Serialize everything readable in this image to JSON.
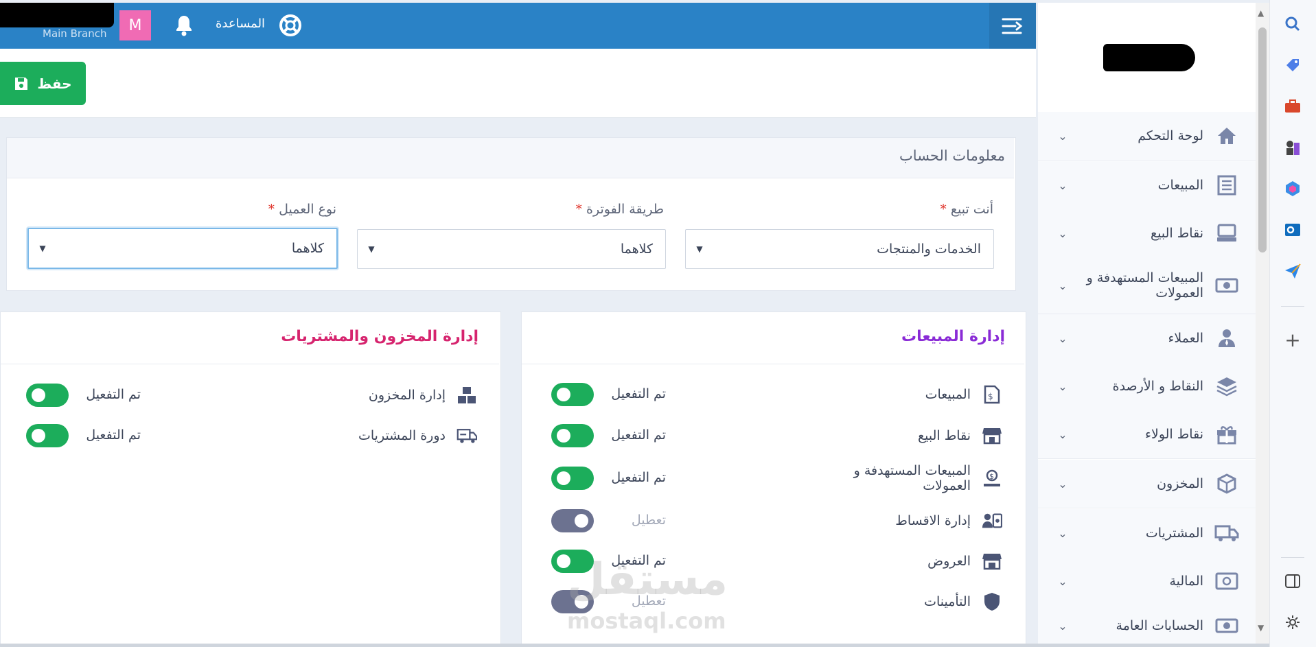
{
  "topbar": {
    "branch": "Main Branch",
    "avatar_initial": "M",
    "help_label": "المساعدة",
    "colors": {
      "bar": "#2a82c6",
      "avatar": "#f06bb4"
    }
  },
  "toolbar": {
    "save_label": "حفظ",
    "save_color": "#1cad5b"
  },
  "sidebar": {
    "items": [
      {
        "label": "لوحة التحكم",
        "icon": "home-icon"
      },
      {
        "label": "المبيعات",
        "icon": "receipt-icon"
      },
      {
        "label": "نقاط البيع",
        "icon": "pos-terminal-icon"
      },
      {
        "label": "المبيعات المستهدفة و العمولات",
        "icon": "money-icon"
      },
      {
        "label": "العملاء",
        "icon": "user-tie-icon"
      },
      {
        "label": "النقاط و الأرصدة",
        "icon": "layers-icon"
      },
      {
        "label": "نقاط الولاء",
        "icon": "gift-icon"
      },
      {
        "label": "المخزون",
        "icon": "box-icon"
      },
      {
        "label": "المشتريات",
        "icon": "truck-icon"
      },
      {
        "label": "المالية",
        "icon": "safe-icon"
      },
      {
        "label": "الحسابات العامة",
        "icon": "money-icon"
      }
    ]
  },
  "account": {
    "title": "معلومات الحساب",
    "fields": [
      {
        "label": "أنت تبيع",
        "required": "*",
        "value": "الخدمات والمنتجات"
      },
      {
        "label": "طريقة الفوترة",
        "required": "*",
        "value": "كلاهما"
      },
      {
        "label": "نوع العميل",
        "required": "*",
        "value": "كلاهما"
      }
    ]
  },
  "sales_card": {
    "title": "إدارة المبيعات",
    "title_color": "#8a2bd6",
    "modules": [
      {
        "label": "المبيعات",
        "status": "تم التفعيل",
        "enabled": true,
        "icon": "invoice-dollar-icon"
      },
      {
        "label": "نقاط البيع",
        "status": "تم التفعيل",
        "enabled": true,
        "icon": "store-icon"
      },
      {
        "label": "المبيعات المستهدفة و العمولات",
        "status": "تم التفعيل",
        "enabled": true,
        "icon": "hand-coin-icon"
      },
      {
        "label": "إدارة الاقساط",
        "status": "تعطيل",
        "enabled": false,
        "icon": "user-money-icon"
      },
      {
        "label": "العروض",
        "status": "تم التفعيل",
        "enabled": true,
        "icon": "shop-icon"
      },
      {
        "label": "التأمينات",
        "status": "تعطيل",
        "enabled": false,
        "icon": "shield-icon"
      }
    ]
  },
  "inventory_card": {
    "title": "إدارة المخزون والمشتريات",
    "title_color": "#d6246e",
    "modules": [
      {
        "label": "إدارة المخزون",
        "status": "تم التفعيل",
        "enabled": true,
        "icon": "boxes-icon"
      },
      {
        "label": "دورة المشتريات",
        "status": "تم التفعيل",
        "enabled": true,
        "icon": "delivery-truck-icon"
      }
    ]
  },
  "watermark": {
    "arabic": "مستقل",
    "latin": "mostaql.com"
  }
}
